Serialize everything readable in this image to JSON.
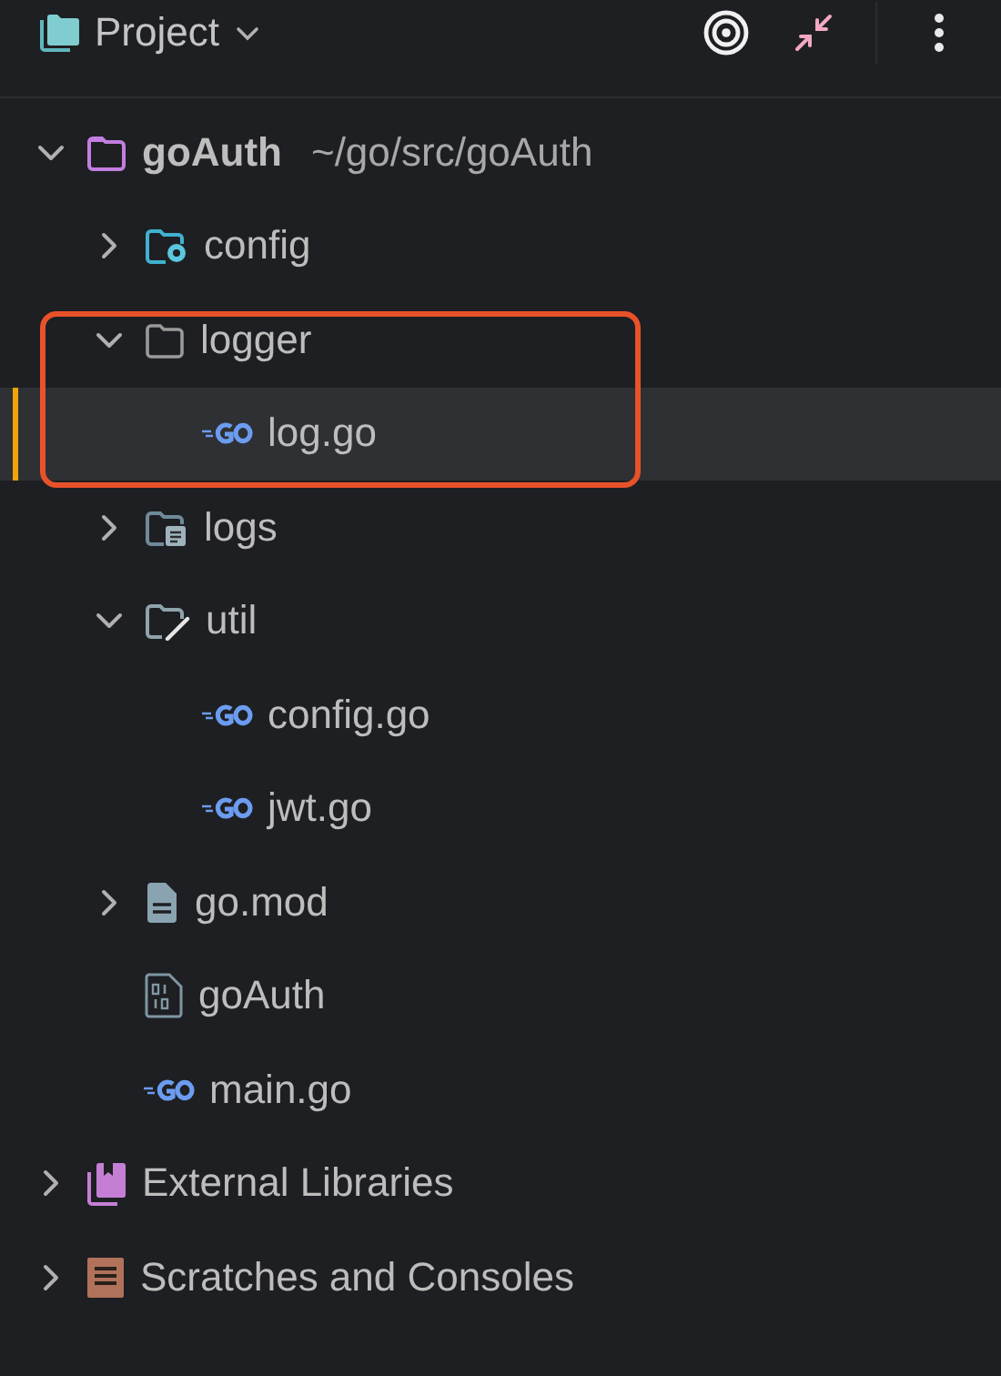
{
  "header": {
    "title": "Project"
  },
  "tree": [
    {
      "kind": "root-folder",
      "name": "goAuth",
      "path": "~/go/src/goAuth",
      "expanded": true,
      "selected": false,
      "children": [
        {
          "kind": "config-folder",
          "name": "config",
          "expanded": false,
          "selected": false
        },
        {
          "kind": "folder",
          "name": "logger",
          "expanded": true,
          "selected": false,
          "boxed": true,
          "children": [
            {
              "kind": "go-file",
              "name": "log.go",
              "selected": true
            }
          ]
        },
        {
          "kind": "logs-folder",
          "name": "logs",
          "expanded": false,
          "selected": false
        },
        {
          "kind": "util-folder",
          "name": "util",
          "expanded": true,
          "selected": false,
          "children": [
            {
              "kind": "go-file",
              "name": "config.go",
              "selected": false
            },
            {
              "kind": "go-file",
              "name": "jwt.go",
              "selected": false
            }
          ]
        },
        {
          "kind": "mod-file",
          "name": "go.mod",
          "expanded": false,
          "selected": false
        },
        {
          "kind": "binary-file",
          "name": "goAuth",
          "selected": false
        },
        {
          "kind": "go-file",
          "name": "main.go",
          "selected": false
        }
      ]
    },
    {
      "kind": "libraries",
      "name": "External Libraries",
      "expanded": false,
      "selected": false
    },
    {
      "kind": "scratches",
      "name": "Scratches and Consoles",
      "expanded": false,
      "selected": false
    }
  ]
}
